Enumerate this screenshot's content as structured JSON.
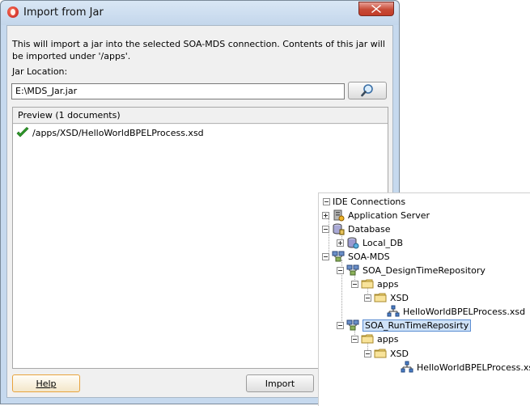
{
  "dialog": {
    "title": "Import from Jar",
    "description": "This will import a jar into the selected SOA-MDS connection. Contents of this jar will be imported under '/apps'.",
    "jar_location_label": "Jar Location:",
    "jar_location_value": "E:\\MDS_Jar.jar",
    "preview_header": "Preview (1 documents)",
    "preview_items": [
      "/apps/XSD/HelloWorldBPELProcess.xsd"
    ],
    "help_button": "Help",
    "import_button": "Import"
  },
  "ide_connections": {
    "header": "IDE Connections",
    "nodes": [
      {
        "label": "Application Server",
        "icon": "application-server-icon",
        "expanded": false
      },
      {
        "label": "Database",
        "icon": "database-icon",
        "expanded": true
      },
      {
        "label": "Local_DB",
        "icon": "database-connection-icon",
        "expanded": false
      },
      {
        "label": "SOA-MDS",
        "icon": "soa-mds-icon",
        "expanded": true
      },
      {
        "label": "SOA_DesignTimeRepository",
        "icon": "mds-repository-icon",
        "expanded": true
      },
      {
        "label": "apps",
        "icon": "folder-icon",
        "expanded": true
      },
      {
        "label": "XSD",
        "icon": "folder-icon",
        "expanded": true
      },
      {
        "label": "HelloWorldBPELProcess.xsd",
        "icon": "xsd-file-icon"
      },
      {
        "label": "SOA_RunTimeReposirty",
        "icon": "mds-repository-icon",
        "expanded": true,
        "selected": true
      },
      {
        "label": "apps",
        "icon": "folder-icon",
        "expanded": true
      },
      {
        "label": "XSD",
        "icon": "folder-icon",
        "expanded": true
      },
      {
        "label": "HelloWorldBPELProcess.xsd",
        "icon": "xsd-file-icon"
      }
    ]
  }
}
